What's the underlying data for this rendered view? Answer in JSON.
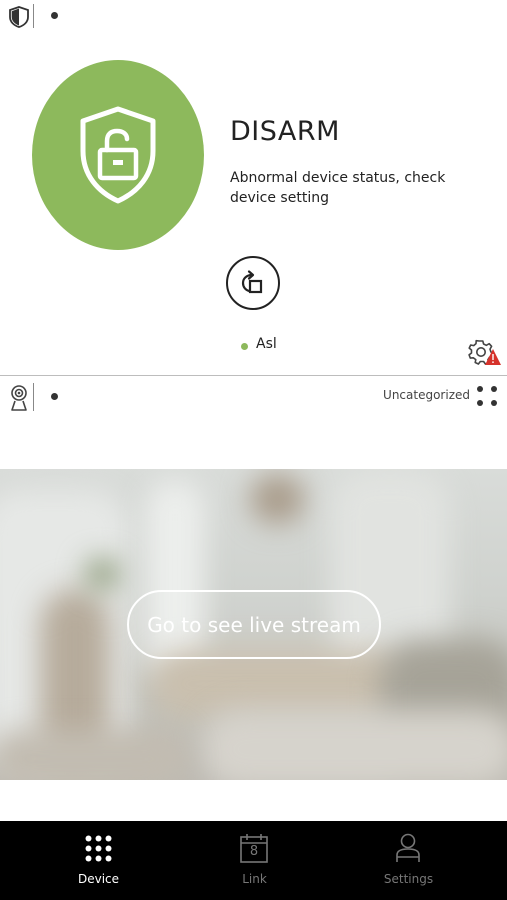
{
  "security_card": {
    "mode": "DISARM",
    "description": "Abnormal device status, check device setting",
    "status_label": "Asl",
    "colors": {
      "mode_circle": "#8db95c",
      "status_dot": "#8db95c",
      "alert": "#d6322b"
    },
    "icons": [
      "shield-icon",
      "unlock-icon",
      "switch-mode-icon",
      "gear-alert-icon"
    ]
  },
  "camera_card": {
    "category": "Uncategorized",
    "live_button_label": "Go to see live stream",
    "icons": [
      "camera-icon",
      "grid-dots-icon"
    ]
  },
  "bottom_nav": {
    "items": [
      {
        "label": "Device",
        "icon": "grid-icon",
        "active": true
      },
      {
        "label": "Link",
        "icon": "calendar-icon",
        "active": false
      },
      {
        "label": "Settings",
        "icon": "user-icon",
        "active": false
      }
    ],
    "calendar_day": "8",
    "colors": {
      "active": "#ffffff",
      "inactive": "#777777"
    }
  }
}
